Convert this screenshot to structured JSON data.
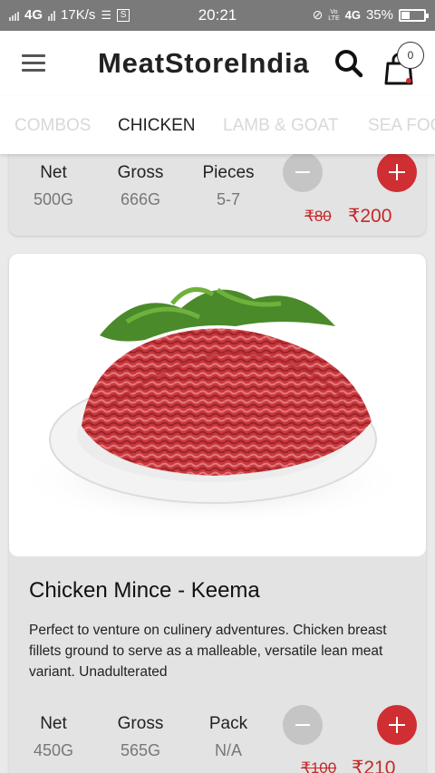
{
  "status_bar": {
    "network": "4G",
    "speed": "17K/s",
    "time": "20:21",
    "volte": "Vo\nLTE",
    "net2": "4G",
    "battery": "35%",
    "battery_level": 0.35
  },
  "header": {
    "brand": "MeatStoreIndia",
    "cart_count": "0"
  },
  "tabs": [
    {
      "label": "COMBOS",
      "active": false
    },
    {
      "label": "CHICKEN",
      "active": true
    },
    {
      "label": "LAMB & GOAT",
      "active": false
    },
    {
      "label": "SEA FOOD",
      "active": false
    }
  ],
  "products": [
    {
      "specs": [
        {
          "label": "Net",
          "value": "500G"
        },
        {
          "label": "Gross",
          "value": "666G"
        },
        {
          "label": "Pieces",
          "value": "5-7"
        }
      ],
      "old_price": "₹80",
      "price": "₹200"
    },
    {
      "title": "Chicken Mince - Keema",
      "description": "Perfect to venture on culinery adventures. Chicken breast fillets ground to serve as a malleable, versatile lean meat variant. Unadulterated",
      "specs": [
        {
          "label": "Net",
          "value": "450G"
        },
        {
          "label": "Gross",
          "value": "565G"
        },
        {
          "label": "Pack",
          "value": "N/A"
        }
      ],
      "old_price": "₹100",
      "price": "₹210"
    }
  ],
  "colors": {
    "accent": "#cf2e33",
    "price": "#c62828"
  }
}
